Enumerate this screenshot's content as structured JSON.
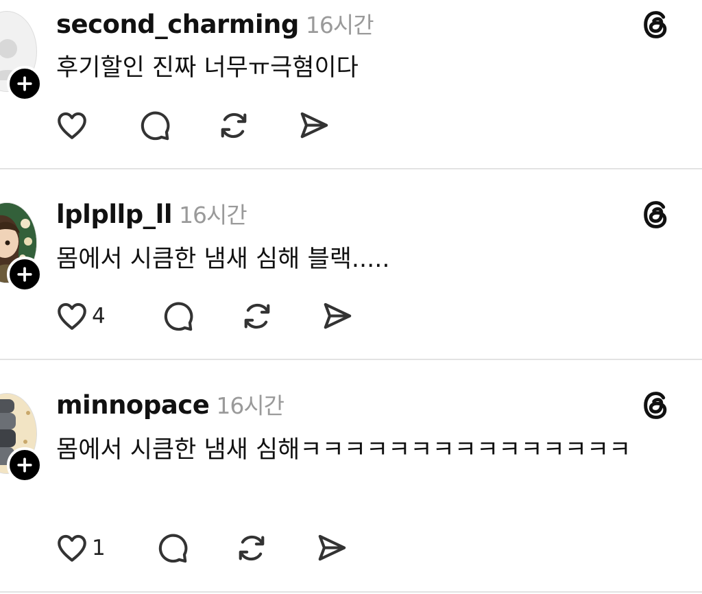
{
  "posts": [
    {
      "username": "second_charming",
      "time": "16시간",
      "text": "후기할인 진짜 너무ㅠ극혐이다",
      "likes": "",
      "icons": [
        "heart-icon",
        "comment-icon",
        "repost-icon",
        "share-icon",
        "threads-logo-icon"
      ]
    },
    {
      "username": "lplpllp_ll",
      "time": "16시간",
      "text": "몸에서 시큼한 냄새 심해 블랙.....",
      "likes": "4",
      "icons": [
        "heart-icon",
        "comment-icon",
        "repost-icon",
        "share-icon",
        "threads-logo-icon"
      ]
    },
    {
      "username": "minnopace",
      "time": "16시간",
      "text": "몸에서 시큼한 냄새 심해ㅋㅋㅋㅋㅋㅋㅋㅋㅋㅋㅋㅋㅋㅋㅋ",
      "likes": "1",
      "icons": [
        "heart-icon",
        "comment-icon",
        "repost-icon",
        "share-icon",
        "threads-logo-icon"
      ]
    }
  ],
  "colors": {
    "background": "#ffffff",
    "text": "#111111",
    "timestamp": "#9a9a9a",
    "divider": "#e2e2e2",
    "icon": "#333333"
  }
}
